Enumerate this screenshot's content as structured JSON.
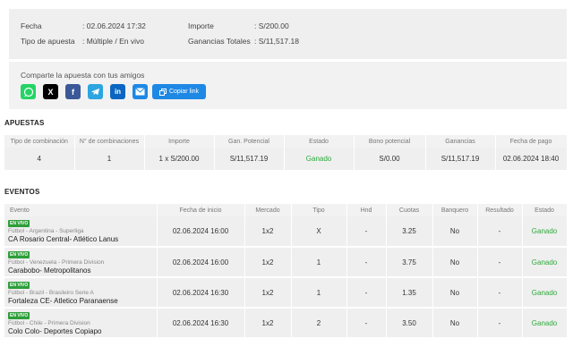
{
  "summary": {
    "fecha_label": "Fecha",
    "fecha": ": 02.06.2024 17:32",
    "tipo_label": "Tipo de apuesta",
    "tipo": ": Múltiple / En vivo",
    "importe_label": "Importe",
    "importe": ": S/200.00",
    "ganancias_label": "Ganancias Totales",
    "ganancias": ": S/11,517.18"
  },
  "share": {
    "title": "Comparte la apuesta con tus amigos",
    "buttons": [
      {
        "icon": "whatsapp-icon",
        "color": "#25d366"
      },
      {
        "icon": "x-icon",
        "color": "#000000"
      },
      {
        "icon": "facebook-icon",
        "color": "#3b5998"
      },
      {
        "icon": "telegram-icon",
        "color": "#2ca5e0"
      },
      {
        "icon": "linkedin-icon",
        "color": "#0a66c2"
      },
      {
        "icon": "email-icon",
        "color": "#1e88e5"
      }
    ],
    "copy_label": "Copiar link"
  },
  "apuestas": {
    "title": "APUESTAS",
    "headers": [
      "Tipo de combinación",
      "N° de combinaciones",
      "Importe",
      "Gan. Potencial",
      "Estado",
      "Bono potencial",
      "Ganancias",
      "Fecha de pago"
    ],
    "row": [
      "4",
      "1",
      "1 x S/200.00",
      "S/11,517.19",
      "Ganado",
      "S/0.00",
      "S/11,517.19",
      "02.06.2024 18:40"
    ]
  },
  "eventos": {
    "title": "EVENTOS",
    "headers": [
      "Evento",
      "Fecha de inicio",
      "Mercado",
      "Tipo",
      "Hnd",
      "Cuotas",
      "Banquero",
      "Resultado",
      "Estado"
    ],
    "rows": [
      {
        "badge": "EN VIVO",
        "league": "Fútbol - Argentina - Superliga",
        "match": "CA Rosario Central- Atlético Lanus",
        "fecha": "02.06.2024 16:00",
        "mercado": "1x2",
        "tipo": "X",
        "hnd": "-",
        "cuota": "3.25",
        "banquero": "No",
        "resultado": "-",
        "estado": "Ganado"
      },
      {
        "badge": "EN VIVO",
        "league": "Fútbol - Venezuela - Primera Division",
        "match": "Carabobo- Metropolitanos",
        "fecha": "02.06.2024 16:00",
        "mercado": "1x2",
        "tipo": "1",
        "hnd": "-",
        "cuota": "3.75",
        "banquero": "No",
        "resultado": "-",
        "estado": "Ganado"
      },
      {
        "badge": "EN VIVO",
        "league": "Fútbol - Brazil - Brasileiro Serie A",
        "match": "Fortaleza CE- Atletico Paranaense",
        "fecha": "02.06.2024 16:30",
        "mercado": "1x2",
        "tipo": "1",
        "hnd": "-",
        "cuota": "1.35",
        "banquero": "No",
        "resultado": "-",
        "estado": "Ganado"
      },
      {
        "badge": "EN VIVO",
        "league": "Fútbol - Chile - Primera Division",
        "match": "Colo Colo- Deportes Copiapo",
        "fecha": "02.06.2024 16:30",
        "mercado": "1x2",
        "tipo": "2",
        "hnd": "-",
        "cuota": "3.50",
        "banquero": "No",
        "resultado": "-",
        "estado": "Ganado"
      }
    ]
  },
  "colors": {
    "win": "#2eaa3a",
    "live_badge": "#2e9e3a",
    "panel": "#efefef"
  }
}
